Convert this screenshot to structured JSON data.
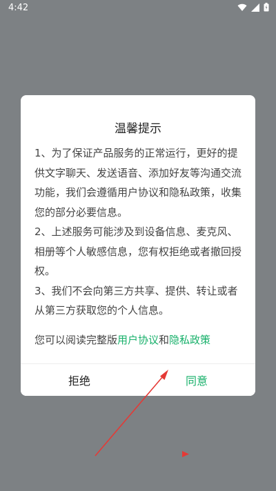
{
  "status_bar": {
    "time": "4:42",
    "icons": [
      "wifi-icon",
      "signal-icon",
      "battery-charging-icon"
    ]
  },
  "dialog": {
    "title": "温馨提示",
    "paragraphs": [
      "1、为了保证产品服务的正常运行，更好的提供文字聊天、发送语音、添加好友等沟通交流功能，我们会遵循用户协议和隐私政策，收集您的部分必要信息。",
      "2、上述服务可能涉及到设备信息、麦克风、相册等个人敏感信息，您有权拒绝或者撤回授权。",
      "3、我们不会向第三方共享、提供、转让或者从第三方获取您的个人信息。"
    ],
    "link_prefix": "您可以阅读完整版",
    "link_user_agreement": "用户协议",
    "link_and": "和",
    "link_privacy_policy": "隐私政策",
    "decline_label": "拒绝",
    "agree_label": "同意"
  },
  "colors": {
    "accent": "#17b06a",
    "overlay": "#7d8184",
    "annotation": "#e53935"
  }
}
